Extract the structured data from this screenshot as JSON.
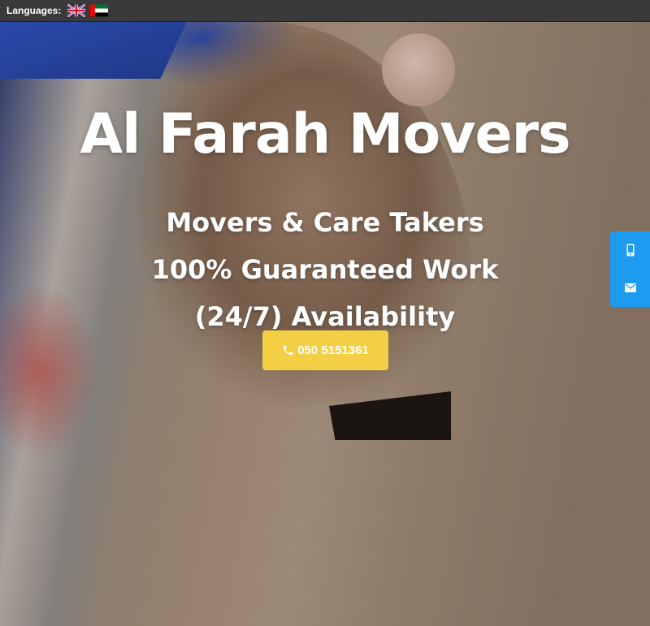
{
  "topbar": {
    "languages_label": "Languages:",
    "flags": [
      {
        "icon": "uk-flag-icon",
        "language": "English"
      },
      {
        "icon": "uae-flag-icon",
        "language": "Arabic"
      }
    ]
  },
  "hero": {
    "title": "Al Farah Movers",
    "taglines": [
      "Movers & Care Takers",
      "100% Guaranteed Work",
      "(24/7) Availability"
    ],
    "phone_button_label": "050 5151361",
    "phone_icon": "phone-icon"
  },
  "side_contact": {
    "items": [
      {
        "icon": "mobile-phone-icon"
      },
      {
        "icon": "envelope-icon"
      }
    ]
  },
  "colors": {
    "topbar_bg": "#3a3a3a",
    "button_bg": "#f3cf45",
    "side_contact_bg": "#1d9bf0",
    "hero_text": "#ffffff"
  }
}
